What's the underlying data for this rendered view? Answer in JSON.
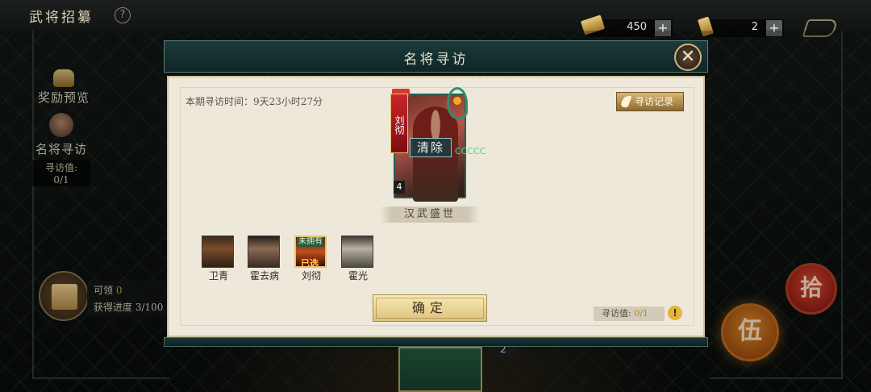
{
  "header": {
    "page_title": "武将招纂",
    "help_glyph": "?"
  },
  "resources": [
    {
      "name": "gold-ingot",
      "value": "450",
      "plus": "+"
    },
    {
      "name": "recruit-token",
      "value": "2",
      "plus": "+"
    }
  ],
  "sidebar": {
    "reward_preview": "奖励预览",
    "famous_visit": "名将寻访",
    "visit_value": "寻访值: 0/1"
  },
  "progress": {
    "claimable_label": "可领",
    "claimable_value": "0",
    "obtain_progress": "获得进度 3/100"
  },
  "draw_buttons": {
    "ten": "拾",
    "five": "伍"
  },
  "modal": {
    "title": "名将寻访",
    "close_glyph": "✕",
    "period": "本期寻访时间：9天23小时27分",
    "history_button": "寻访记录",
    "card": {
      "hero_name": "刘彻",
      "level": "4",
      "rings": "CCCCC"
    },
    "clear_button": "清除",
    "set_name": "汉武盛世",
    "heroes": [
      {
        "name": "卫青",
        "not_owned": "",
        "stamp": ""
      },
      {
        "name": "霍去病",
        "not_owned": "",
        "stamp": ""
      },
      {
        "name": "刘彻",
        "not_owned": "未拥有",
        "stamp": "已选"
      },
      {
        "name": "霍光",
        "not_owned": "",
        "stamp": ""
      }
    ],
    "confirm_button": "确定",
    "visit_value_label": "寻访值:",
    "visit_value": "0/1",
    "info_glyph": "!"
  },
  "bottom": {
    "count": "2"
  }
}
